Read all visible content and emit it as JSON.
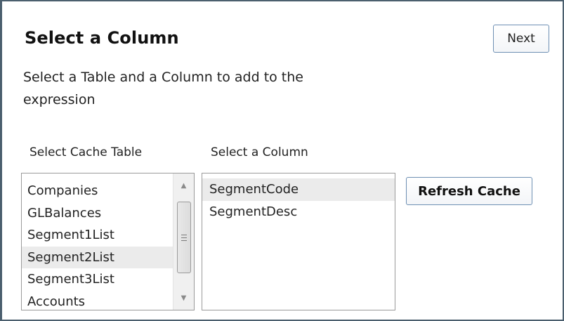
{
  "header": {
    "title": "Select a Column",
    "next_label": "Next"
  },
  "description": "Select a Table and a Column to add to the expression",
  "cache_table": {
    "label": "Select Cache Table",
    "items": [
      "Companies",
      "GLBalances",
      "Segment1List",
      "Segment2List",
      "Segment3List",
      "Accounts"
    ],
    "selected": "Segment2List",
    "scrollbar": {
      "up_icon": "scroll-up-arrow",
      "down_icon": "scroll-down-arrow"
    }
  },
  "column": {
    "label": "Select a Column",
    "items": [
      "SegmentCode",
      "SegmentDesc"
    ],
    "selected": "SegmentCode"
  },
  "refresh_label": "Refresh Cache",
  "colors": {
    "border": "#4b5f6e",
    "button_border": "#6d8fb3",
    "selection": "#ebebeb"
  }
}
